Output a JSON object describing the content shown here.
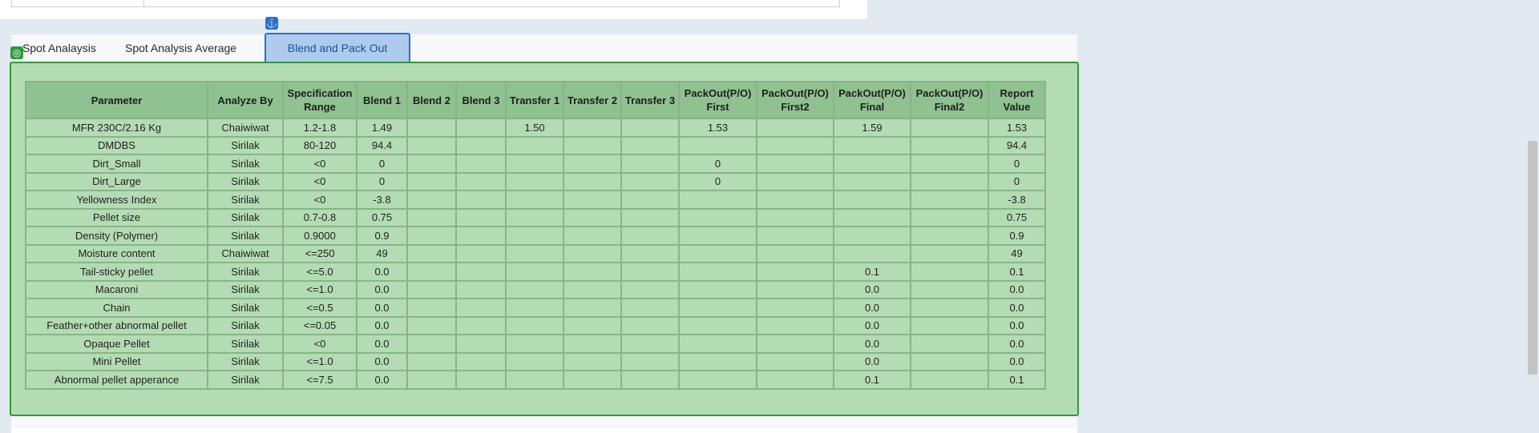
{
  "tabs": {
    "items": [
      {
        "label": "Spot Analaysis"
      },
      {
        "label": "Spot Analysis Average"
      },
      {
        "label": "Blend and Pack Out Analysis"
      }
    ],
    "active_index": 2,
    "anchor_icon": "⚓",
    "target_icon": "◎"
  },
  "table": {
    "columns": [
      "Parameter",
      "Analyze By",
      "Specification Range",
      "Blend 1",
      "Blend 2",
      "Blend 3",
      "Transfer 1",
      "Transfer 2",
      "Transfer 3",
      "PackOut(P/O) First",
      "PackOut(P/O) First2",
      "PackOut(P/O) Final",
      "PackOut(P/O) Final2",
      "Report Value"
    ],
    "rows": [
      [
        "MFR 230C/2.16 Kg",
        "Chaiwiwat",
        "1.2-1.8",
        "1.49",
        "",
        "",
        "1.50",
        "",
        "",
        "1.53",
        "",
        "1.59",
        "",
        "1.53"
      ],
      [
        "DMDBS",
        "Sirilak",
        "80-120",
        "94.4",
        "",
        "",
        "",
        "",
        "",
        "",
        "",
        "",
        "",
        "94.4"
      ],
      [
        "Dirt_Small",
        "Sirilak",
        "<0",
        "0",
        "",
        "",
        "",
        "",
        "",
        "0",
        "",
        "",
        "",
        "0"
      ],
      [
        "Dirt_Large",
        "Sirilak",
        "<0",
        "0",
        "",
        "",
        "",
        "",
        "",
        "0",
        "",
        "",
        "",
        "0"
      ],
      [
        "Yellowness Index",
        "Sirilak",
        "<0",
        "-3.8",
        "",
        "",
        "",
        "",
        "",
        "",
        "",
        "",
        "",
        "-3.8"
      ],
      [
        "Pellet size",
        "Sirilak",
        "0.7-0.8",
        "0.75",
        "",
        "",
        "",
        "",
        "",
        "",
        "",
        "",
        "",
        "0.75"
      ],
      [
        "Density (Polymer)",
        "Sirilak",
        "0.9000",
        "0.9",
        "",
        "",
        "",
        "",
        "",
        "",
        "",
        "",
        "",
        "0.9"
      ],
      [
        "Moisture content",
        "Chaiwiwat",
        "<=250",
        "49",
        "",
        "",
        "",
        "",
        "",
        "",
        "",
        "",
        "",
        "49"
      ],
      [
        "Tail-sticky pellet",
        "Sirilak",
        "<=5.0",
        "0.0",
        "",
        "",
        "",
        "",
        "",
        "",
        "",
        "0.1",
        "",
        "0.1"
      ],
      [
        "Macaroni",
        "Sirilak",
        "<=1.0",
        "0.0",
        "",
        "",
        "",
        "",
        "",
        "",
        "",
        "0.0",
        "",
        "0.0"
      ],
      [
        "Chain",
        "Sirilak",
        "<=0.5",
        "0.0",
        "",
        "",
        "",
        "",
        "",
        "",
        "",
        "0.0",
        "",
        "0.0"
      ],
      [
        "Feather+other abnormal pellet",
        "Sirilak",
        "<=0.05",
        "0.0",
        "",
        "",
        "",
        "",
        "",
        "",
        "",
        "0.0",
        "",
        "0.0"
      ],
      [
        "Opaque Pellet",
        "Sirilak",
        "<0",
        "0.0",
        "",
        "",
        "",
        "",
        "",
        "",
        "",
        "0.0",
        "",
        "0.0"
      ],
      [
        "Mini Pellet",
        "Sirilak",
        "<=1.0",
        "0.0",
        "",
        "",
        "",
        "",
        "",
        "",
        "",
        "0.0",
        "",
        "0.0"
      ],
      [
        "Abnormal pellet apperance",
        "Sirilak",
        "<=7.5",
        "0.0",
        "",
        "",
        "",
        "",
        "",
        "",
        "",
        "0.1",
        "",
        "0.1"
      ]
    ]
  },
  "colors": {
    "grid_bg": "#b4dcb4",
    "header_bg": "#90c190",
    "active_tab_bg": "#aecbee",
    "active_tab_border": "#2a6fd1",
    "grid_border": "#2f9a35"
  }
}
